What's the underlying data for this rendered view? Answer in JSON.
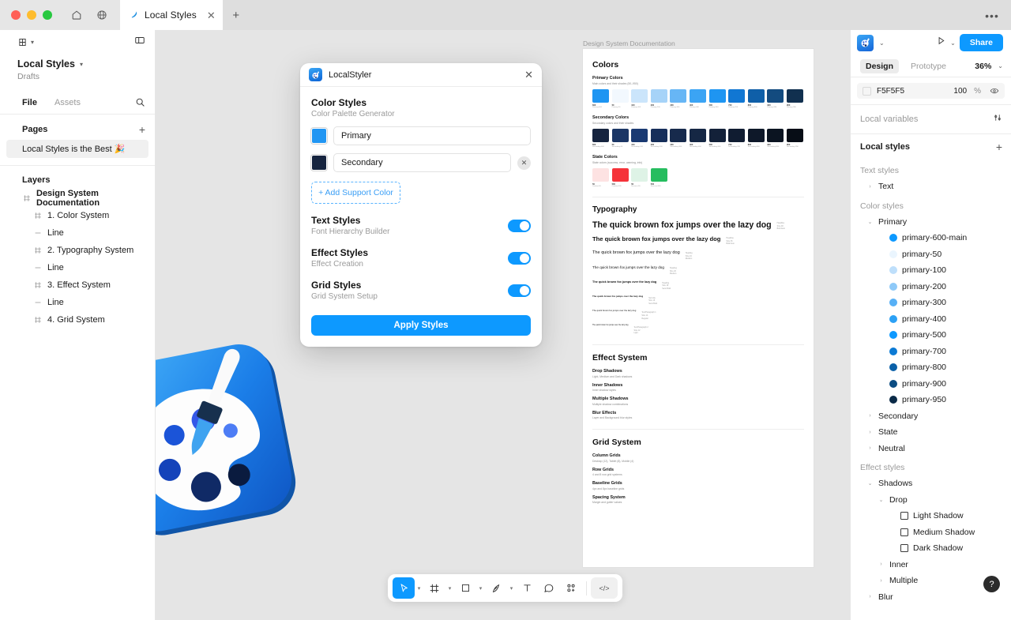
{
  "titlebar": {
    "home_icon": "home-icon",
    "globe_icon": "globe-icon",
    "tab_label": "Local Styles",
    "tab_close": "✕",
    "new_tab": "+",
    "overflow": "•••"
  },
  "left_panel": {
    "menu_icon": "figma-menu-icon",
    "layout_icon": "panel-toggle-icon",
    "file_title": "Local Styles",
    "file_sub": "Drafts",
    "tabs": [
      {
        "label": "File",
        "active": true
      },
      {
        "label": "Assets",
        "active": false
      }
    ],
    "search_icon": "search-icon",
    "pages_title": "Pages",
    "pages_add": "+",
    "pages": [
      {
        "label": "Local Styles is the Best 🎉",
        "selected": true
      }
    ],
    "layers_title": "Layers",
    "layers": [
      {
        "label": "Design System Documentation",
        "type": "frame",
        "indent": 0,
        "bold": true
      },
      {
        "label": "1. Color System",
        "type": "frame",
        "indent": 1,
        "bold": false
      },
      {
        "label": "Line",
        "type": "line",
        "indent": 1,
        "bold": false
      },
      {
        "label": "2. Typography System",
        "type": "frame",
        "indent": 1,
        "bold": false
      },
      {
        "label": "Line",
        "type": "line",
        "indent": 1,
        "bold": false
      },
      {
        "label": "3. Effect System",
        "type": "frame",
        "indent": 1,
        "bold": false
      },
      {
        "label": "Line",
        "type": "line",
        "indent": 1,
        "bold": false
      },
      {
        "label": "4. Grid System",
        "type": "frame",
        "indent": 1,
        "bold": false
      }
    ]
  },
  "dialog": {
    "icon": "palette-app-icon",
    "title": "LocalStyler",
    "close": "✕",
    "section_title": "Color Styles",
    "section_sub": "Color Palette Generator",
    "colors": [
      {
        "name": "Primary",
        "swatch": "#2196f3",
        "removable": false
      },
      {
        "name": "Secondary",
        "swatch": "#16243f",
        "removable": true
      }
    ],
    "remove_icon": "✕",
    "add_support_color": "+ Add Support Color",
    "toggles": [
      {
        "title": "Text Styles",
        "sub": "Font Hierarchy Builder",
        "on": true
      },
      {
        "title": "Effect Styles",
        "sub": "Effect Creation",
        "on": true
      },
      {
        "title": "Grid Styles",
        "sub": "Grid System Setup",
        "on": true
      }
    ],
    "apply_label": "Apply Styles",
    "accent": "#0d99ff"
  },
  "canvas": {
    "frame_label": "Design System Documentation",
    "doc": {
      "colors_title": "Colors",
      "primary": {
        "title": "Primary Colors",
        "sub": "Main colors and their shades (50–950)",
        "swatches": [
          {
            "hex": "#1e95f2",
            "tone": "600",
            "name": "Primary-600"
          },
          {
            "hex": "#f2f8fe",
            "tone": "50",
            "name": "Primary-50"
          },
          {
            "hex": "#cbe5fb",
            "tone": "100",
            "name": "Primary-100"
          },
          {
            "hex": "#a6d3f8",
            "tone": "200",
            "name": "Primary-200"
          },
          {
            "hex": "#67b6f5",
            "tone": "300",
            "name": "Primary-300"
          },
          {
            "hex": "#3ba4f4",
            "tone": "400",
            "name": "Primary-400"
          },
          {
            "hex": "#1e95f2",
            "tone": "500",
            "name": "Primary-500"
          },
          {
            "hex": "#1177d3",
            "tone": "700",
            "name": "Primary-700"
          },
          {
            "hex": "#0f5fa8",
            "tone": "800",
            "name": "Primary-800"
          },
          {
            "hex": "#134b7f",
            "tone": "900",
            "name": "Primary-900"
          },
          {
            "hex": "#11304f",
            "tone": "950",
            "name": "Primary-950"
          }
        ]
      },
      "secondary": {
        "title": "Secondary Colors",
        "sub": "Secondary colors and their shades",
        "swatches": [
          {
            "hex": "#16243f",
            "tone": "600",
            "name": "Secondary-600"
          },
          {
            "hex": "#1b3665",
            "tone": "50",
            "name": "Secondary-50"
          },
          {
            "hex": "#1a3a72",
            "tone": "100",
            "name": "Secondary-100"
          },
          {
            "hex": "#162e5a",
            "tone": "200",
            "name": "Secondary-200"
          },
          {
            "hex": "#172a4c",
            "tone": "300",
            "name": "Secondary-300"
          },
          {
            "hex": "#152744",
            "tone": "400",
            "name": "Secondary-400"
          },
          {
            "hex": "#132139",
            "tone": "500",
            "name": "Secondary-500"
          },
          {
            "hex": "#101c31",
            "tone": "700",
            "name": "Secondary-700"
          },
          {
            "hex": "#0e1829",
            "tone": "800",
            "name": "Secondary-800"
          },
          {
            "hex": "#0b1421",
            "tone": "900",
            "name": "Secondary-900"
          },
          {
            "hex": "#070d16",
            "tone": "950",
            "name": "Secondary-950"
          }
        ]
      },
      "state": {
        "title": "State Colors",
        "sub": "State colors (success, error, warning, info)",
        "swatches": [
          {
            "hex": "#fde2e2",
            "tone": "50",
            "name": "Caution-50"
          },
          {
            "hex": "#f5333a",
            "tone": "500",
            "name": "Caution-500"
          },
          {
            "hex": "#def3e6",
            "tone": "50",
            "name": "Success-50"
          },
          {
            "hex": "#26bd5f",
            "tone": "500",
            "name": "Success-500"
          }
        ]
      },
      "typography_title": "Typography",
      "type_specimen": "The quick brown fox jumps over the lazy dog",
      "type_rows": [
        {
          "size": 10.6,
          "weight": 700,
          "meta": "Headline\nSize 48\nBold Auto"
        },
        {
          "size": 7.6,
          "weight": 700,
          "meta": "Headline\nSize 36\nBold Auto"
        },
        {
          "size": 5.6,
          "weight": 400,
          "meta": "Heading\nSize 24\nMedium"
        },
        {
          "size": 4.6,
          "weight": 400,
          "meta": "Heading\nSize 20\nMedium"
        },
        {
          "size": 3.8,
          "weight": 700,
          "meta": "Heading\nSize 18\nSemi Bold"
        },
        {
          "size": 3.0,
          "weight": 700,
          "meta": "Sub title\nSize 16\nSemi Bold"
        },
        {
          "size": 2.8,
          "weight": 400,
          "meta": "Text/Paragraph 1\nSize 14\nRegular"
        },
        {
          "size": 2.3,
          "weight": 400,
          "meta": "Text/Paragraph 2\nSize 12\nLight"
        }
      ],
      "effect_title": "Effect System",
      "effects": [
        {
          "title": "Drop Shadows",
          "sub": "Light, Medium and Dark shadows"
        },
        {
          "title": "Inner Shadows",
          "sub": "Inner shadow styles"
        },
        {
          "title": "Multiple Shadows",
          "sub": "Multiple shadow combinations"
        },
        {
          "title": "Blur Effects",
          "sub": "Layer and Background blur styles"
        }
      ],
      "grid_title": "Grid System",
      "grids": [
        {
          "title": "Column Grids",
          "sub": "Desktop (12), Tablet (8), Mobile (4)"
        },
        {
          "title": "Row Grids",
          "sub": "4 and 8 row grid systems"
        },
        {
          "title": "Baseline Grids",
          "sub": "4px and 8px baseline grids"
        },
        {
          "title": "Spacing System",
          "sub": "Margin and gutter values"
        }
      ]
    }
  },
  "right_panel": {
    "avatar_icon": "palette-app-icon",
    "avatar_caret": "⌄",
    "present_icon": "play-icon",
    "present_caret": "⌄",
    "share_label": "Share",
    "tabs": [
      {
        "label": "Design",
        "active": true
      },
      {
        "label": "Prototype",
        "active": false
      }
    ],
    "zoom": "36%",
    "zoom_caret": "⌄",
    "fill": {
      "hex": "F5F5F5",
      "opacity": "100",
      "unit": "%",
      "eye_icon": "eye-icon"
    },
    "local_variables": {
      "label": "Local variables",
      "icon": "sliders-icon"
    },
    "local_styles": {
      "label": "Local styles",
      "add": "+"
    },
    "text_styles_label": "Text styles",
    "text_styles": [
      {
        "label": "Text",
        "caret": "›",
        "indent": 1
      }
    ],
    "color_styles_label": "Color styles",
    "color_groups": [
      {
        "label": "Primary",
        "caret": "⌄",
        "indent": 1,
        "expanded": true
      },
      {
        "label": "primary-600-main",
        "dot": "#0d99ff",
        "indent": 2
      },
      {
        "label": "primary-50",
        "dot": "#eaf5fe",
        "indent": 2
      },
      {
        "label": "primary-100",
        "dot": "#bedffb",
        "indent": 2
      },
      {
        "label": "primary-200",
        "dot": "#8ec9f8",
        "indent": 2
      },
      {
        "label": "primary-300",
        "dot": "#57b0f6",
        "indent": 2
      },
      {
        "label": "primary-400",
        "dot": "#2ca1f5",
        "indent": 2
      },
      {
        "label": "primary-500",
        "dot": "#0d99ff",
        "indent": 2
      },
      {
        "label": "primary-700",
        "dot": "#0b7ad4",
        "indent": 2
      },
      {
        "label": "primary-800",
        "dot": "#0a60a8",
        "indent": 2
      },
      {
        "label": "primary-900",
        "dot": "#0b4c82",
        "indent": 2
      },
      {
        "label": "primary-950",
        "dot": "#0a2a47",
        "indent": 2
      },
      {
        "label": "Secondary",
        "caret": "›",
        "indent": 1,
        "expanded": false
      },
      {
        "label": "State",
        "caret": "›",
        "indent": 1,
        "expanded": false
      },
      {
        "label": "Neutral",
        "caret": "›",
        "indent": 1,
        "expanded": false
      }
    ],
    "effect_styles_label": "Effect styles",
    "effect_tree": [
      {
        "label": "Shadows",
        "caret": "⌄",
        "indent": 1,
        "kind": "group"
      },
      {
        "label": "Drop",
        "caret": "⌄",
        "indent": 2,
        "kind": "group"
      },
      {
        "label": "Light Shadow",
        "indent": 3,
        "kind": "style"
      },
      {
        "label": "Medium Shadow",
        "indent": 3,
        "kind": "style"
      },
      {
        "label": "Dark Shadow",
        "indent": 3,
        "kind": "style"
      },
      {
        "label": "Inner",
        "caret": "›",
        "indent": 2,
        "kind": "group"
      },
      {
        "label": "Multiple",
        "caret": "›",
        "indent": 2,
        "kind": "group"
      },
      {
        "label": "Blur",
        "caret": "›",
        "indent": 1,
        "kind": "group"
      }
    ],
    "help_label": "?"
  },
  "toolbar": {
    "tools": [
      {
        "name": "move-tool",
        "glyph": "cursor",
        "active": true,
        "caret": true
      },
      {
        "name": "frame-tool",
        "glyph": "frame",
        "active": false,
        "caret": true
      },
      {
        "name": "shape-tool",
        "glyph": "square",
        "active": false,
        "caret": true
      },
      {
        "name": "pen-tool",
        "glyph": "pen",
        "active": false,
        "caret": true
      },
      {
        "name": "text-tool",
        "glyph": "text",
        "active": false,
        "caret": false
      },
      {
        "name": "comment-tool",
        "glyph": "comment",
        "active": false,
        "caret": false
      },
      {
        "name": "actions-tool",
        "glyph": "actions",
        "active": false,
        "caret": false
      }
    ],
    "dev_mode": "</>"
  }
}
